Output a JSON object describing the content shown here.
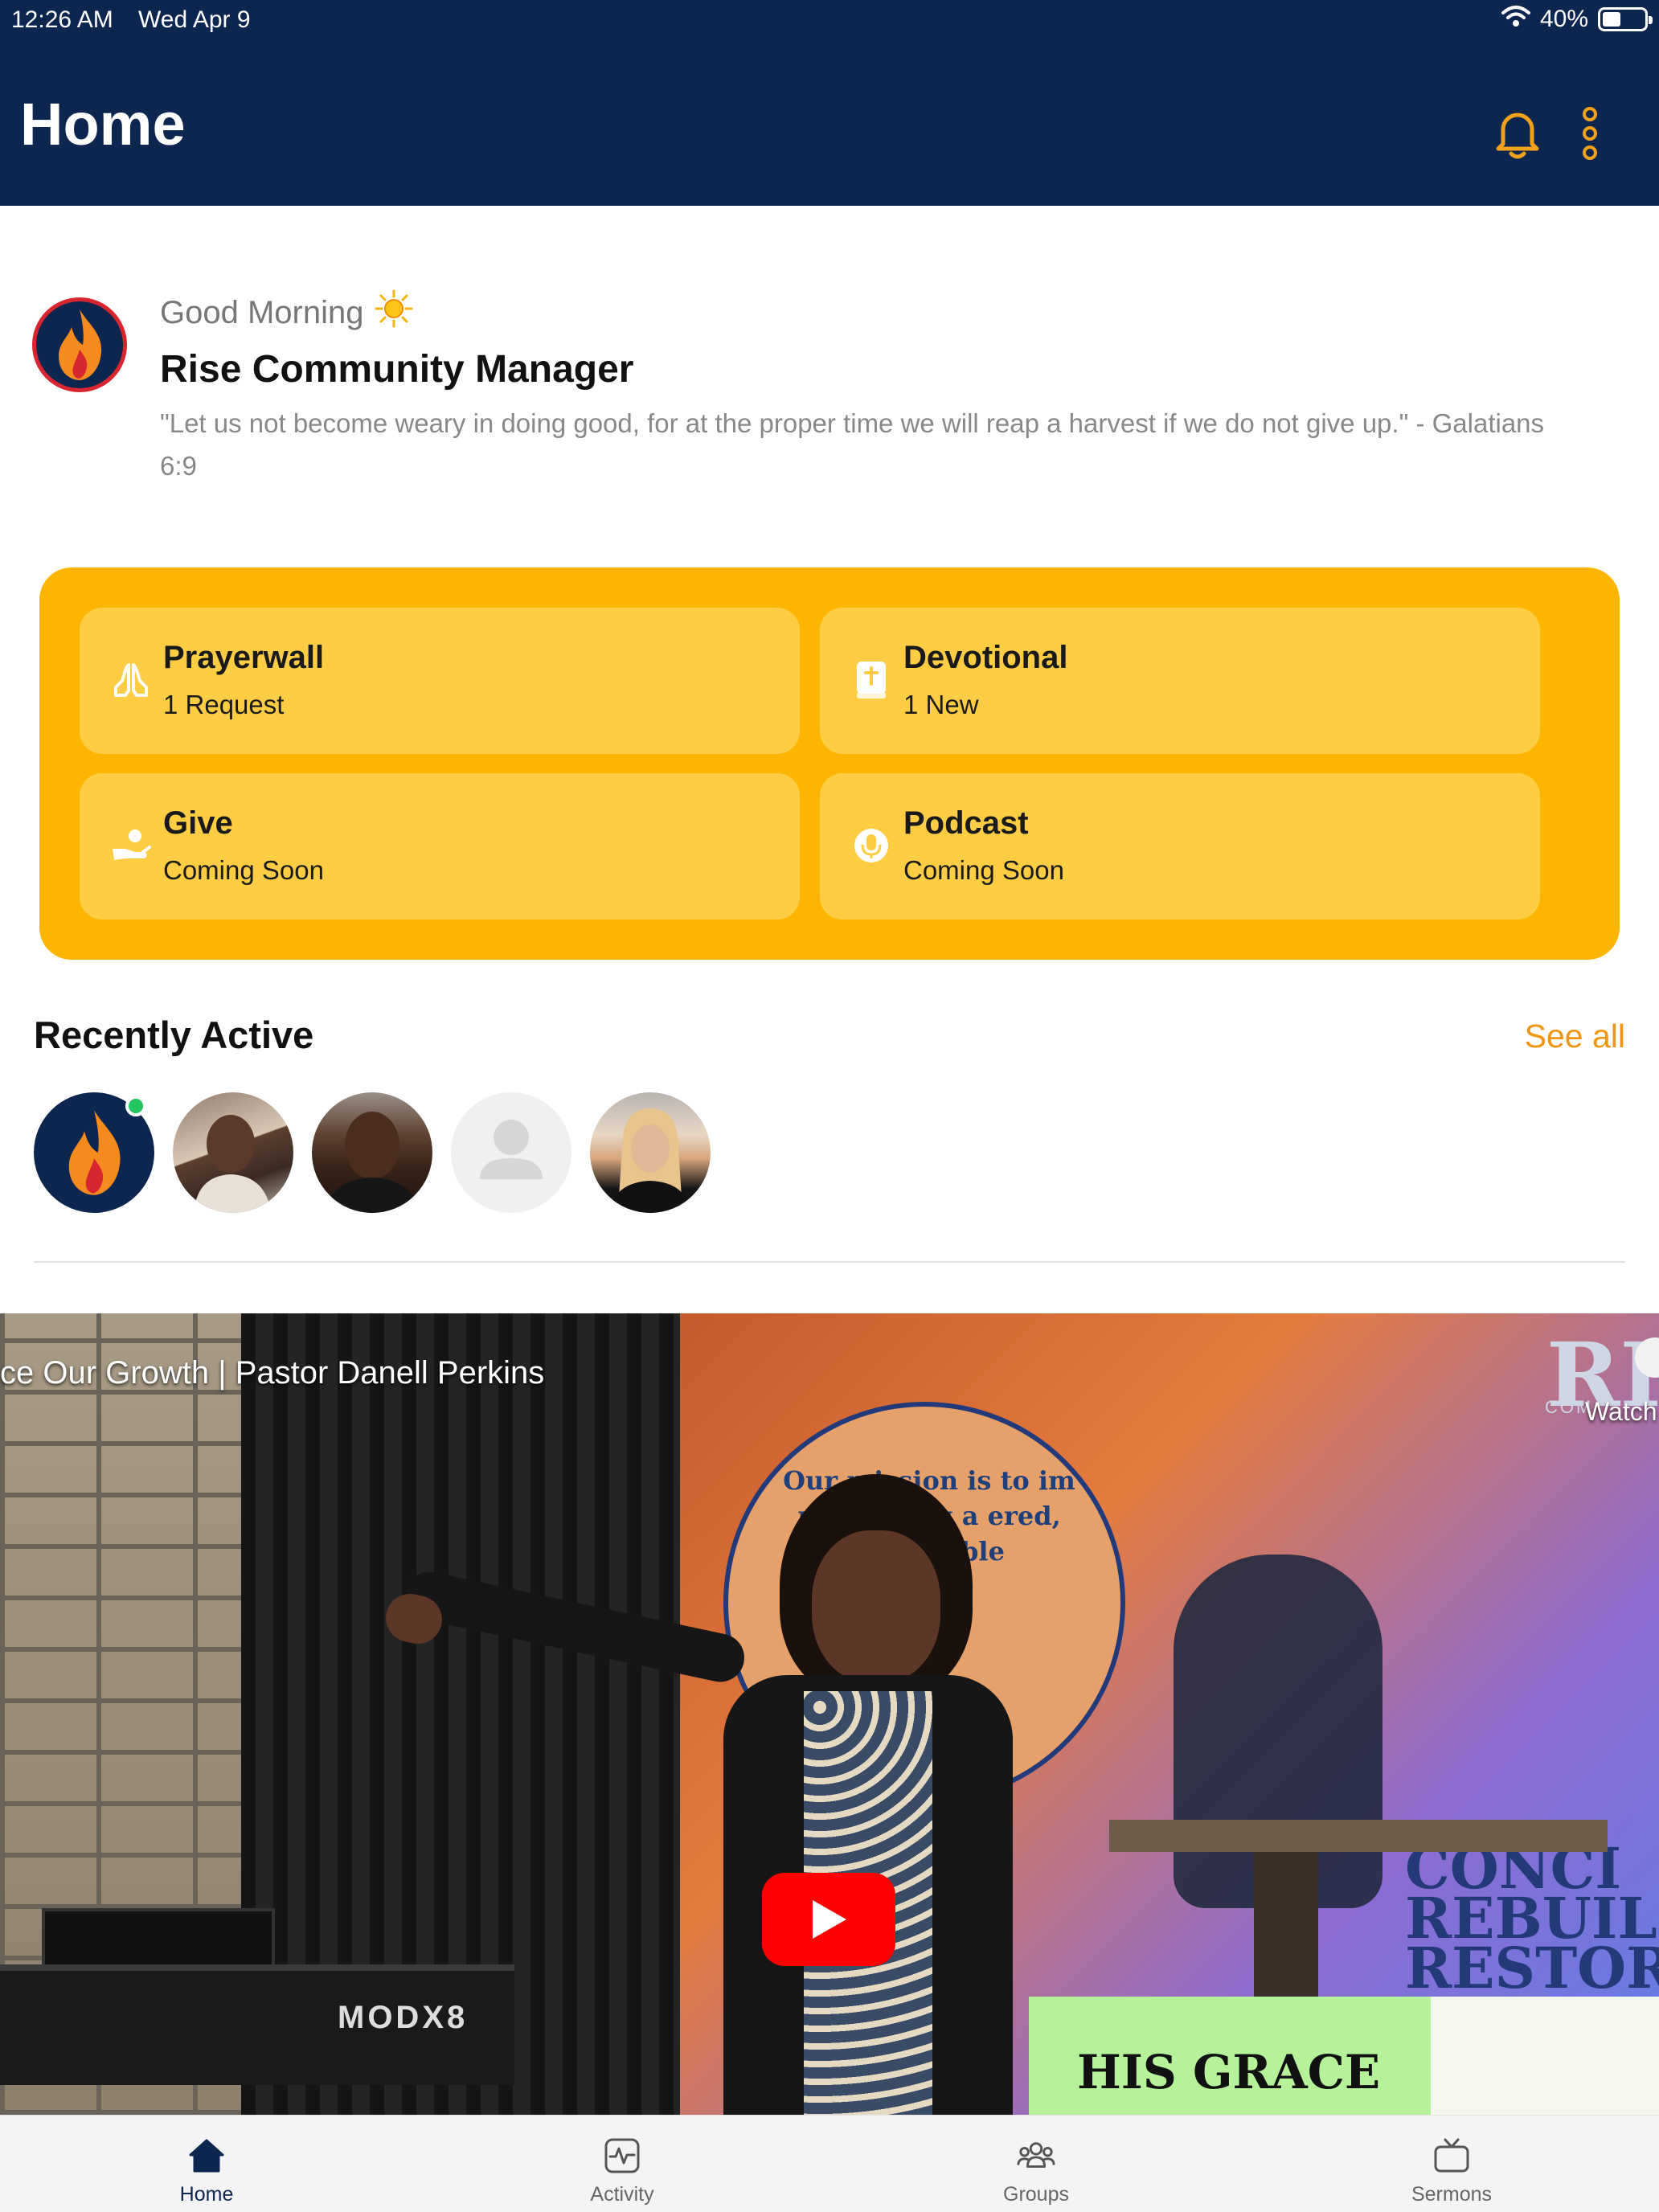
{
  "status_bar": {
    "time": "12:26 AM",
    "date": "Wed Apr 9",
    "battery": "40%"
  },
  "header": {
    "title": "Home",
    "notifications_icon": "bell-icon",
    "more_icon": "more-vertical-icon"
  },
  "greeting": {
    "label": "Good Morning",
    "name": "Rise Community Manager",
    "verse": "\"Let us not become weary in doing good, for at the proper time we will reap a harvest if we do not give up.\" - Galatians 6:9"
  },
  "quick_actions": [
    {
      "title": "Prayerwall",
      "subtitle": "1 Request",
      "icon": "praying-hands-icon"
    },
    {
      "title": "Devotional",
      "subtitle": "1 New",
      "icon": "bible-icon"
    },
    {
      "title": "Give",
      "subtitle": "Coming Soon",
      "icon": "hand-giving-icon"
    },
    {
      "title": "Podcast",
      "subtitle": "Coming Soon",
      "icon": "microphone-icon"
    }
  ],
  "recently_active": {
    "title": "Recently Active",
    "see_all": "See all"
  },
  "video": {
    "title": "ce Our Growth | Pastor Danell Perkins",
    "watch_label": "Watch",
    "channel_logo": "RI",
    "channel_sub": "COM",
    "scene_circle_text": "Our mission is to im mmunity g a ered, vered, ible",
    "scene_keyboard": "MODX8",
    "scene_banner": "CONCI REBUIL RESTOR",
    "scene_sign": "HIS GRACE"
  },
  "tabbar": [
    {
      "label": "Home",
      "icon": "home-icon",
      "active": true
    },
    {
      "label": "Activity",
      "icon": "activity-icon",
      "active": false
    },
    {
      "label": "Groups",
      "icon": "groups-icon",
      "active": false
    },
    {
      "label": "Sermons",
      "icon": "tv-icon",
      "active": false
    }
  ],
  "colors": {
    "header_bg": "#0d2650",
    "accent_orange": "#f0950f",
    "panel_yellow": "#feb500",
    "card_yellow": "#fecd43",
    "online_green": "#22c55e"
  }
}
